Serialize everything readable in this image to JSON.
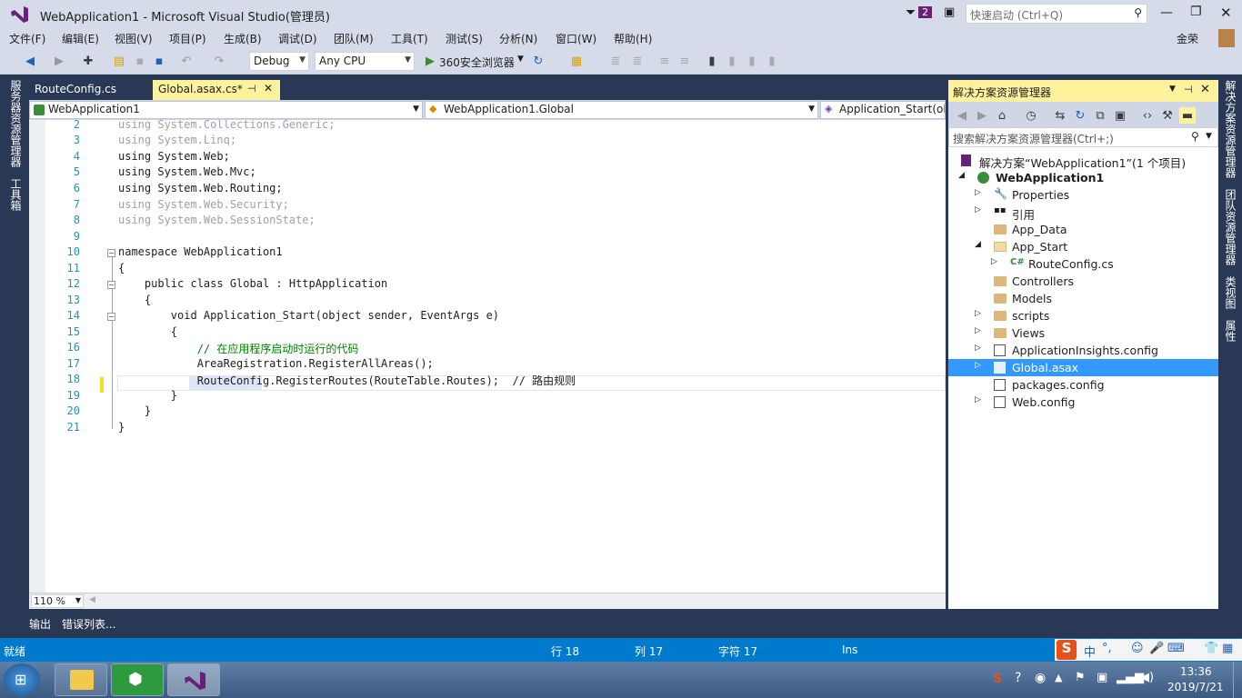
{
  "window": {
    "title": "WebApplication1 - Microsoft Visual Studio(管理员)",
    "notification_count": "2",
    "quick_launch_placeholder": "快速启动 (Ctrl+Q)",
    "user": "金荣"
  },
  "menu": [
    "文件(F)",
    "编辑(E)",
    "视图(V)",
    "项目(P)",
    "生成(B)",
    "调试(D)",
    "团队(M)",
    "工具(T)",
    "测试(S)",
    "分析(N)",
    "窗口(W)",
    "帮助(H)"
  ],
  "toolbar": {
    "config": "Debug",
    "platform": "Any CPU",
    "run_label": "360安全浏览器"
  },
  "left_tabs": [
    "服务器资源管理器",
    "工具箱"
  ],
  "doc_tabs": [
    {
      "label": "RouteConfig.cs",
      "active": false
    },
    {
      "label": "Global.asax.cs*",
      "active": true
    }
  ],
  "nav": {
    "project": "WebApplication1",
    "class": "WebApplication1.Global",
    "member": "Application_Start(ob"
  },
  "code_lines": [
    {
      "n": "2",
      "text": "using System.Collections.Generic;"
    },
    {
      "n": "3",
      "text": "using System.Linq;"
    },
    {
      "n": "4",
      "text": "using System.Web;"
    },
    {
      "n": "5",
      "text": "using System.Web.Mvc;"
    },
    {
      "n": "6",
      "text": "using System.Web.Routing;"
    },
    {
      "n": "7",
      "text": "using System.Web.Security;"
    },
    {
      "n": "8",
      "text": "using System.Web.SessionState;"
    },
    {
      "n": "9",
      "text": ""
    },
    {
      "n": "10",
      "text": "namespace WebApplication1"
    },
    {
      "n": "11",
      "text": "{"
    },
    {
      "n": "12",
      "text": "    public class Global : HttpApplication"
    },
    {
      "n": "13",
      "text": "    {"
    },
    {
      "n": "14",
      "text": "        void Application_Start(object sender, EventArgs e)"
    },
    {
      "n": "15",
      "text": "        {"
    },
    {
      "n": "16",
      "text": "            // 在应用程序启动时运行的代码"
    },
    {
      "n": "17",
      "text": "            AreaRegistration.RegisterAllAreas();"
    },
    {
      "n": "18",
      "text": "            RouteConfig.RegisterRoutes(RouteTable.Routes);  // 路由规则"
    },
    {
      "n": "19",
      "text": "        }"
    },
    {
      "n": "20",
      "text": "    }"
    },
    {
      "n": "21",
      "text": "}"
    }
  ],
  "zoom": "110 %",
  "solution_explorer": {
    "title": "解决方案资源管理器",
    "search_placeholder": "搜索解决方案资源管理器(Ctrl+;)",
    "nodes": [
      {
        "label": "解决方案“WebApplication1”(1 个项目)",
        "level": 0,
        "icon": "solution-icon",
        "expander": ""
      },
      {
        "label": "WebApplication1",
        "level": 1,
        "icon": "web-project-icon",
        "expander": "◢",
        "bold": true
      },
      {
        "label": "Properties",
        "level": 2,
        "icon": "wrench-icon",
        "expander": "▷"
      },
      {
        "label": "引用",
        "level": 2,
        "icon": "references-icon",
        "expander": "▷"
      },
      {
        "label": "App_Data",
        "level": 2,
        "icon": "folder-icon",
        "expander": ""
      },
      {
        "label": "App_Start",
        "level": 2,
        "icon": "folder-open-icon",
        "expander": "◢"
      },
      {
        "label": "RouteConfig.cs",
        "level": 3,
        "icon": "csharp-file-icon",
        "expander": "▷"
      },
      {
        "label": "Controllers",
        "level": 2,
        "icon": "folder-icon",
        "expander": ""
      },
      {
        "label": "Models",
        "level": 2,
        "icon": "folder-icon",
        "expander": ""
      },
      {
        "label": "scripts",
        "level": 2,
        "icon": "folder-icon",
        "expander": "▷"
      },
      {
        "label": "Views",
        "level": 2,
        "icon": "folder-icon",
        "expander": "▷"
      },
      {
        "label": "ApplicationInsights.config",
        "level": 2,
        "icon": "config-file-icon",
        "expander": "▷"
      },
      {
        "label": "Global.asax",
        "level": 2,
        "icon": "asax-file-icon",
        "expander": "▷",
        "selected": true
      },
      {
        "label": "packages.config",
        "level": 2,
        "icon": "config-file-icon",
        "expander": ""
      },
      {
        "label": "Web.config",
        "level": 2,
        "icon": "config-file-icon",
        "expander": "▷"
      }
    ]
  },
  "right_tabs": [
    "解决方案资源管理器",
    "团队资源管理器",
    "类视图",
    "属性"
  ],
  "output_tabs": [
    "输出",
    "错误列表..."
  ],
  "status": {
    "ready": "就绪",
    "row": "行 18",
    "col": "列 17",
    "char": "字符 17",
    "mode": "Ins"
  },
  "clock": {
    "time": "13:36",
    "date": "2019/7/21"
  },
  "colors": {
    "status_bar": "#007acc",
    "selection": "#3399ff",
    "frame": "#293955"
  }
}
